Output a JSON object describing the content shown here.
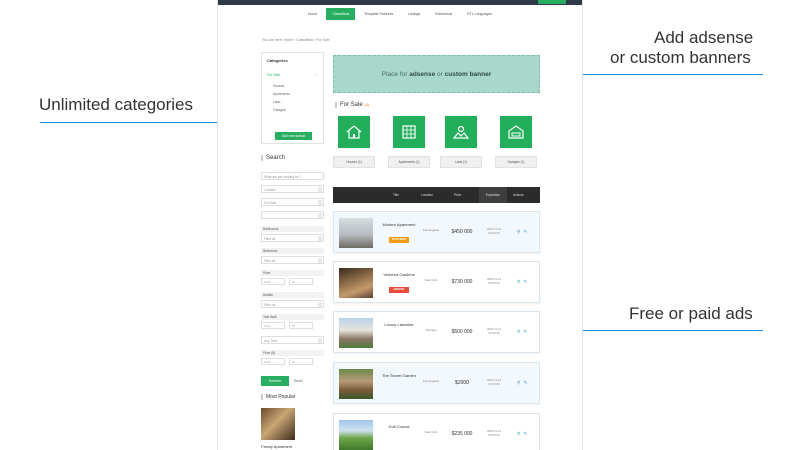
{
  "callouts": {
    "top_right_line1": "Add adsense",
    "top_right_line2": "or custom banners",
    "left": "Unlimited categories",
    "bottom_right": "Free or paid ads"
  },
  "nav": {
    "items": [
      "Home",
      "Classifieds",
      "Template Features",
      "Listings",
      "Extensions",
      "RTL Languages"
    ]
  },
  "breadcrumb": "You are here: Home › Classifieds › For Sale",
  "sidebar": {
    "categories_title": "Categories",
    "active_category": "For Sale",
    "subcategories": [
      "Houses",
      "Apartments",
      "Land",
      "Garages"
    ],
    "add_subcategory": "Add new subcat",
    "search_title": "Search",
    "keyword_placeholder": "What are you looking for ?",
    "location_value": "Location",
    "category_value": "For Sale",
    "labels": {
      "bathrooms": "Bathrooms",
      "bedrooms": "Bedrooms",
      "price": "Price",
      "details": "Details",
      "year_built": "Year Built",
      "price_range": "Price ($)"
    },
    "filter_all": "Filter all",
    "any_time": "Any Time",
    "from": "From",
    "to": "To",
    "search_button": "Search",
    "reset": "Reset",
    "popular_title": "Most Popular",
    "popular_item": "Family Apartment"
  },
  "main": {
    "banner_prefix": "Place for ",
    "banner_adsense": "adsense",
    "banner_middle": " or ",
    "banner_custom": "custom banner",
    "for_sale_title": "For Sale",
    "for_sale_count": "(4)",
    "category_tiles": [
      {
        "label": "Houses (1)",
        "icon": "house-icon"
      },
      {
        "label": "Apartments (1)",
        "icon": "apartment-icon"
      },
      {
        "label": "Land (1)",
        "icon": "land-icon"
      },
      {
        "label": "Garages (1)",
        "icon": "garage-icon"
      }
    ],
    "table_headers": [
      "Title",
      "Location",
      "Price",
      "Expiration",
      "Actions"
    ],
    "listings": [
      {
        "title": "Modern Apartment",
        "badge": "FEATURED",
        "badge_color": "#f39c12",
        "location": "Los Angeles",
        "price": "$450 000",
        "date": "2020-11-21 00:00:00",
        "actions": "⚲ ✎"
      },
      {
        "title": "Verbena Gardens",
        "badge": "URGENT",
        "badge_color": "#e74c3c",
        "location": "New York",
        "price": "$730 000",
        "date": "2020-11-21 00:00:00",
        "actions": "⚲ ✎"
      },
      {
        "title": "Luxury Lakeside",
        "badge": "",
        "badge_color": "",
        "location": "Chicago",
        "price": "$500 000",
        "date": "2020-11-21 00:00:00",
        "actions": "⚲ ✎"
      },
      {
        "title": "The Secret Garden",
        "badge": "",
        "badge_color": "",
        "location": "Los Angeles",
        "price": "$2000",
        "date": "2020-11-21 00:00:00",
        "actions": "⚲ ✎"
      },
      {
        "title": "Golf Course",
        "badge": "",
        "badge_color": "",
        "location": "New York",
        "price": "$235 000",
        "date": "2020-11-21 00:00:00",
        "actions": "⚲ ✎"
      }
    ]
  },
  "colors": {
    "accent_green": "#27ae60",
    "callout_blue": "#1f8dd6",
    "banner_bg": "#a8d8cc",
    "header_dark": "#2b2b2b"
  }
}
